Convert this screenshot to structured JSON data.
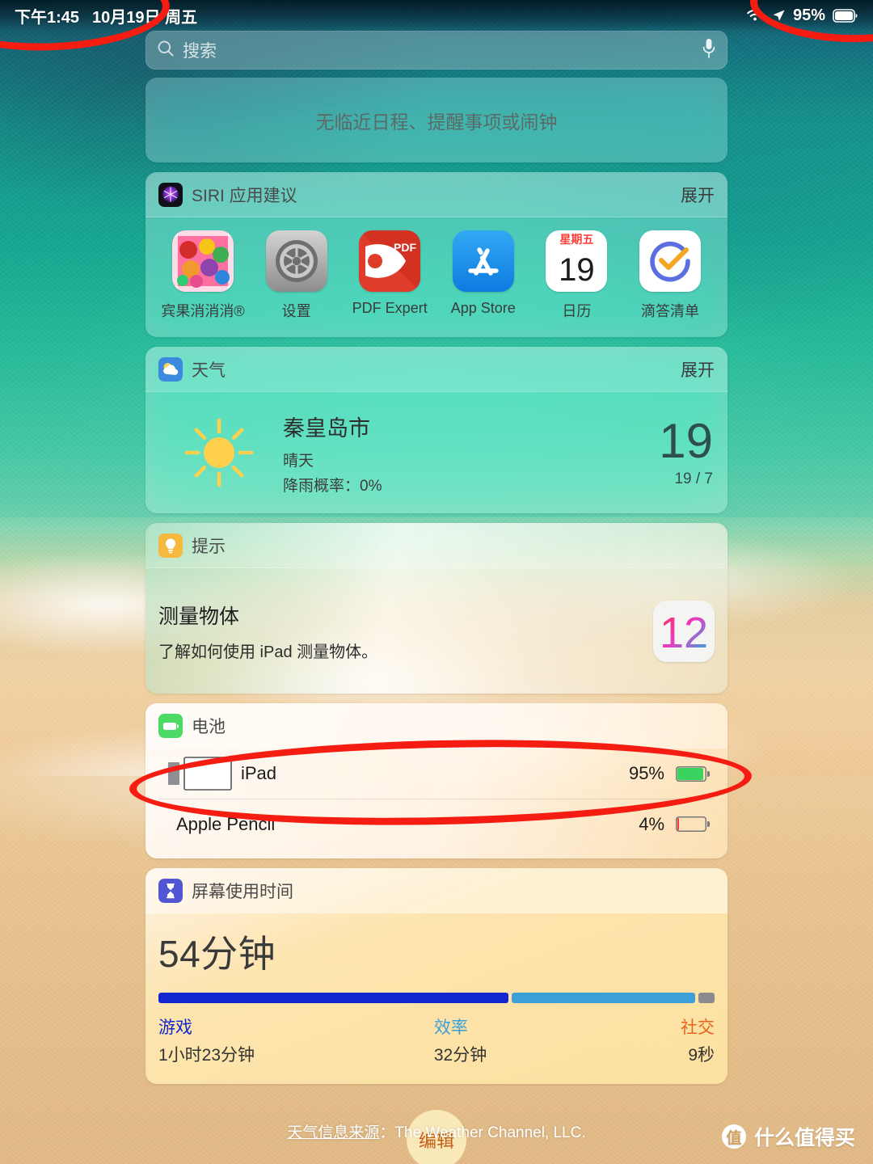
{
  "statusbar": {
    "time": "下午1:45",
    "date": "10月19日 周五",
    "wifi_icon": "wifi-icon",
    "location_icon": "location-arrow-icon",
    "battery_percent": "95%",
    "battery_icon": "battery-full-icon"
  },
  "search": {
    "placeholder": "搜索",
    "value": "",
    "icon": "search-icon",
    "mic_icon": "microphone-icon"
  },
  "upnext": {
    "empty_text": "无临近日程、提醒事项或闹钟"
  },
  "siri": {
    "title": "SIRI 应用建议",
    "action": "展开",
    "badge_icon": "siri-icon",
    "apps": [
      {
        "label": "宾果消消消®",
        "icon": "candy-game-icon"
      },
      {
        "label": "设置",
        "icon": "settings-gear-icon"
      },
      {
        "label": "PDF Expert",
        "icon": "pdf-expert-icon",
        "badge_text": "PDF"
      },
      {
        "label": "App Store",
        "icon": "app-store-icon"
      },
      {
        "label": "日历",
        "icon": "calendar-icon",
        "weekday": "星期五",
        "day": "19"
      },
      {
        "label": "滴答清单",
        "icon": "ticktick-icon"
      }
    ]
  },
  "weather": {
    "title": "天气",
    "action": "展开",
    "badge_icon": "weather-icon",
    "condition_icon": "sun-icon",
    "city": "秦皇岛市",
    "condition": "晴天",
    "rain_chance": "降雨概率：0%",
    "temp": "19",
    "high_low": "19 / 7"
  },
  "tips": {
    "title": "提示",
    "action": "",
    "badge_icon": "tips-lightbulb-icon",
    "headline": "测量物体",
    "sub": "了解如何使用 iPad 测量物体。",
    "badge_number": "12"
  },
  "battery": {
    "title": "电池",
    "badge_icon": "battery-icon",
    "rows": [
      {
        "name": "iPad",
        "percent": "95%",
        "level": 95,
        "color": "#3ad35f",
        "device_icon": "ipad-with-pencil-icon"
      },
      {
        "name": "Apple Pencil",
        "percent": "4%",
        "level": 4,
        "color": "#ff3b30",
        "device_icon": "apple-pencil-icon"
      }
    ]
  },
  "screentime": {
    "title": "屏幕使用时间",
    "badge_icon": "hourglass-icon",
    "total": "54分钟",
    "segments": [
      {
        "label": "游戏",
        "value": "1小时23分钟",
        "color": "#1226cf",
        "pct": 63
      },
      {
        "label": "效率",
        "value": "32分钟",
        "color": "#3d9fd6",
        "pct": 33
      },
      {
        "label": "社交",
        "value": "9秒",
        "color": "#8a8a8f",
        "pct": 4
      }
    ],
    "legend_colors": {
      "游戏": "#1226cf",
      "效率": "#3d9fd6",
      "社交": "#e8641c"
    }
  },
  "edit": {
    "label": "编辑"
  },
  "footer": {
    "link_text": "天气信息来源",
    "rest_text": "：The Weather Channel, LLC."
  },
  "watermark": {
    "badge": "值",
    "text": "什么值得买"
  },
  "annotations": {
    "color": "#f51d12",
    "shapes": [
      {
        "name": "time-highlight",
        "target": "statusbar-time"
      },
      {
        "name": "battery-highlight",
        "target": "statusbar-battery"
      },
      {
        "name": "apple-pencil-highlight",
        "target": "battery-row-apple-pencil"
      }
    ]
  }
}
